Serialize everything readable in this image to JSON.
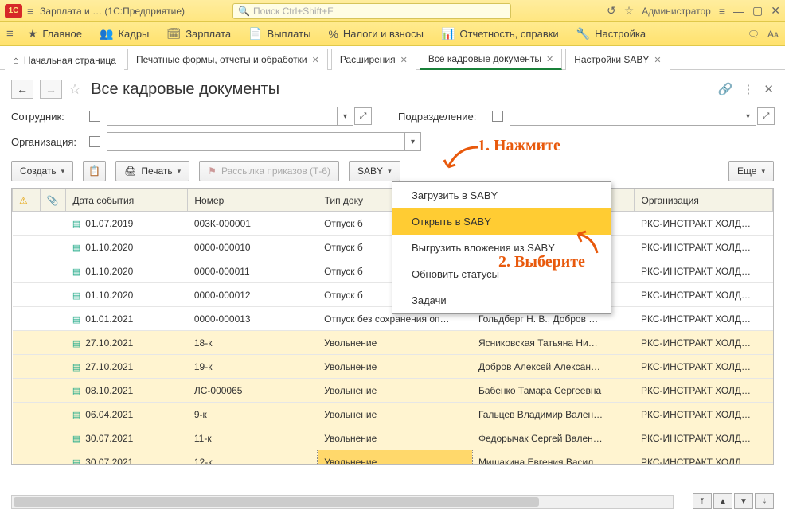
{
  "titlebar": {
    "appTitle": "Зарплата и …   (1С:Предприятие)",
    "searchPlaceholder": "Поиск Ctrl+Shift+F",
    "admin": "Администратор"
  },
  "mainmenu": [
    {
      "icon": "★",
      "label": "Главное"
    },
    {
      "icon": "👥",
      "label": "Кадры"
    },
    {
      "icon": "🗓",
      "label": "Зарплата"
    },
    {
      "icon": "📄",
      "label": "Выплаты"
    },
    {
      "icon": "%",
      "label": "Налоги и взносы"
    },
    {
      "icon": "📊",
      "label": "Отчетность, справки"
    },
    {
      "icon": "🔧",
      "label": "Настройка"
    }
  ],
  "tabs": {
    "home": "Начальная страница",
    "items": [
      {
        "label": "Печатные формы, отчеты и обработки"
      },
      {
        "label": "Расширения"
      },
      {
        "label": "Все кадровые документы",
        "active": true
      },
      {
        "label": "Настройки SABY"
      }
    ]
  },
  "page": {
    "title": "Все кадровые документы"
  },
  "filters": {
    "employeeLabel": "Сотрудник:",
    "deptLabel": "Подразделение:",
    "orgLabel": "Организация:"
  },
  "toolbar": {
    "create": "Создать",
    "print": "Печать",
    "mailing": "Рассылка приказов (Т-6)",
    "saby": "SABY",
    "more": "Еще"
  },
  "sabyMenu": [
    "Загрузить в SABY",
    "Открыть в SABY",
    "Выгрузить вложения из SABY",
    "Обновить статусы",
    "Задачи"
  ],
  "annotations": {
    "a1": "1. Нажмите",
    "a2": "2. Выберите"
  },
  "table": {
    "headers": {
      "warn": "⚠",
      "clip": "📎",
      "date": "Дата события",
      "num": "Номер",
      "type": "Тип доку",
      "emp": "",
      "org": "Организация"
    },
    "rows": [
      {
        "y": false,
        "date": "01.07.2019",
        "num": "003К-000001",
        "type": "Отпуск б",
        "emp": "",
        "org": "РКС-ИНСТРАКТ ХОЛД…"
      },
      {
        "y": false,
        "date": "01.10.2020",
        "num": "0000-000010",
        "type": "Отпуск б",
        "emp": "",
        "org": "РКС-ИНСТРАКТ ХОЛД…"
      },
      {
        "y": false,
        "date": "01.10.2020",
        "num": "0000-000011",
        "type": "Отпуск б",
        "emp": "",
        "org": "РКС-ИНСТРАКТ ХОЛД…"
      },
      {
        "y": false,
        "date": "01.10.2020",
        "num": "0000-000012",
        "type": "Отпуск б",
        "emp": "",
        "org": "РКС-ИНСТРАКТ ХОЛД…"
      },
      {
        "y": false,
        "date": "01.01.2021",
        "num": "0000-000013",
        "type": "Отпуск без сохранения оп…",
        "emp": "Гольдберг Н. В., Добров …",
        "org": "РКС-ИНСТРАКТ ХОЛД…"
      },
      {
        "y": true,
        "date": "27.10.2021",
        "num": "18-к",
        "type": "Увольнение",
        "emp": "Ясниковская Татьяна Ни…",
        "org": "РКС-ИНСТРАКТ ХОЛД…"
      },
      {
        "y": true,
        "date": "27.10.2021",
        "num": "19-к",
        "type": "Увольнение",
        "emp": "Добров Алексей Алексан…",
        "org": "РКС-ИНСТРАКТ ХОЛД…"
      },
      {
        "y": true,
        "date": "08.10.2021",
        "num": "ЛС-000065",
        "type": "Увольнение",
        "emp": "Бабенко Тамара Сергеевна",
        "org": "РКС-ИНСТРАКТ ХОЛД…"
      },
      {
        "y": true,
        "date": "06.04.2021",
        "num": "9-к",
        "type": "Увольнение",
        "emp": "Гальцев Владимир Вален…",
        "org": "РКС-ИНСТРАКТ ХОЛД…"
      },
      {
        "y": true,
        "date": "30.07.2021",
        "num": "11-к",
        "type": "Увольнение",
        "emp": "Федорычак Сергей Вален…",
        "org": "РКС-ИНСТРАКТ ХОЛД…"
      },
      {
        "y": true,
        "date": "30.07.2021",
        "num": "12-к",
        "type": "Увольнение",
        "emp": "Мишакина Евгения Васил…",
        "org": "РКС-ИНСТРАКТ ХОЛД…",
        "sel": true
      }
    ]
  }
}
